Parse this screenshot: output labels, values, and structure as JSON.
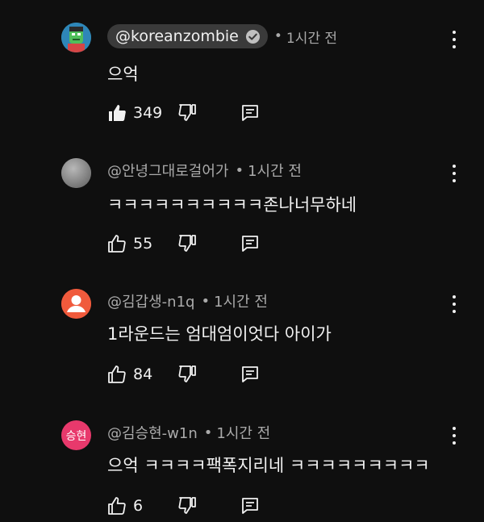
{
  "comments": [
    {
      "author": "@koreanzombie",
      "verified": true,
      "time": "1시간 전",
      "text": "으억",
      "likes": "349",
      "liked": true,
      "avatar_color": "#3fa9c9"
    },
    {
      "author": "@안녕그대로걸어가",
      "verified": false,
      "time": "1시간 전",
      "text": "ㅋㅋㅋㅋㅋㅋㅋㅋㅋㅋ존나너무하네",
      "likes": "55",
      "liked": false,
      "avatar_color": "#8a8a8a"
    },
    {
      "author": "@김갑생-n1q",
      "verified": false,
      "time": "1시간 전",
      "text": "1라운드는 엄대엄이엇다 아이가",
      "likes": "84",
      "liked": false,
      "avatar_color": "#f05a3c"
    },
    {
      "author": "@김승현-w1n",
      "verified": false,
      "time": "1시간 전",
      "text": "으억 ㅋㅋㅋㅋ팩폭지리네 ㅋㅋㅋㅋㅋㅋㅋㅋㅋ",
      "likes": "6",
      "liked": false,
      "avatar_color": "#e8396c",
      "avatar_text": "승현"
    }
  ],
  "separator": "•",
  "icons": {
    "like": "thumbs-up-icon",
    "dislike": "thumbs-down-icon",
    "reply": "reply-icon",
    "more": "more-vert-icon",
    "verified": "verified-check-icon"
  }
}
